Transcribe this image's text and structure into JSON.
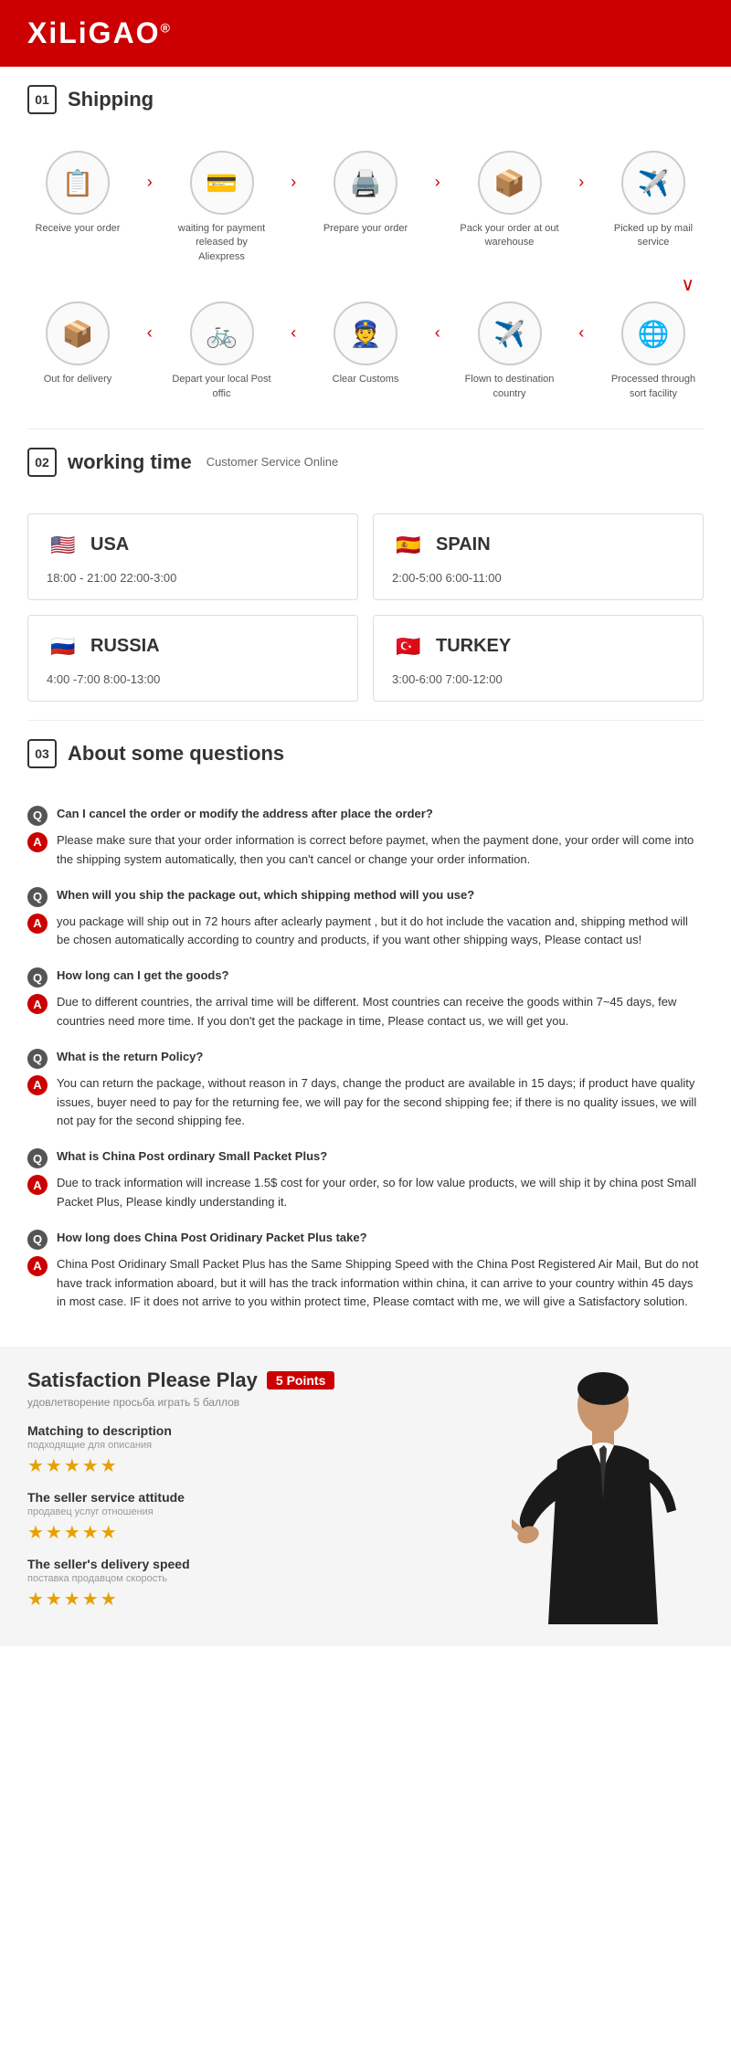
{
  "header": {
    "logo": "XiLiGAO",
    "trademark": "®"
  },
  "shipping": {
    "section_num": "01",
    "section_label": "Shipping",
    "row1": [
      {
        "icon": "📋",
        "label": "Receive your order"
      },
      {
        "arrow": ">"
      },
      {
        "icon": "💳",
        "label": "waiting for payment released by Aliexpress"
      },
      {
        "arrow": ">"
      },
      {
        "icon": "🖨️",
        "label": "Prepare your order"
      },
      {
        "arrow": ">"
      },
      {
        "icon": "📦",
        "label": "Pack your order at out warehouse"
      },
      {
        "arrow": ">"
      },
      {
        "icon": "✈️",
        "label": "Picked up by mail service"
      }
    ],
    "arrow_down": "∨",
    "row2": [
      {
        "icon": "📦",
        "label": "Out for delivery"
      },
      {
        "arrow": "<"
      },
      {
        "icon": "🚲",
        "label": "Depart your local Post offic"
      },
      {
        "arrow": "<"
      },
      {
        "icon": "👮",
        "label": "Clear Customs"
      },
      {
        "arrow": "<"
      },
      {
        "icon": "✈️",
        "label": "Flown to destination country"
      },
      {
        "arrow": "<"
      },
      {
        "icon": "🌐",
        "label": "Processed through sort facility"
      }
    ]
  },
  "working": {
    "section_num": "02",
    "section_label": "working time",
    "section_sublabel": "Customer Service Online",
    "countries": [
      {
        "flag": "🇺🇸",
        "name": "USA",
        "times": "18:00 - 21:00  22:00-3:00"
      },
      {
        "flag": "🇪🇸",
        "name": "SPAIN",
        "times": "2:00-5:00  6:00-11:00"
      },
      {
        "flag": "🇷🇺",
        "name": "RUSSIA",
        "times": "4:00 -7:00  8:00-13:00"
      },
      {
        "flag": "🇹🇷",
        "name": "TURKEY",
        "times": "3:00-6:00  7:00-12:00"
      }
    ]
  },
  "questions": {
    "section_num": "03",
    "section_label": "About some questions",
    "items": [
      {
        "q": "Can I cancel the order or modify the address after place the order?",
        "a": "Please make sure that your order information is correct before paymet, when the payment done, your order will come into the shipping system automatically, then you can't cancel or change your order information."
      },
      {
        "q": "When will you ship the package out, which shipping method will you use?",
        "a": "you package will ship out in 72 hours after aclearly payment , but it do hot include the vacation and, shipping method will be chosen automatically according to country and products, if you want other shipping ways, Please contact us!"
      },
      {
        "q": "How long can I get the goods?",
        "a": "Due to different countries, the arrival time will be different. Most countries can receive the goods within 7~45 days, few countries need more time. If you don't get the package in time, Please contact us, we will get you."
      },
      {
        "q": "What is the return Policy?",
        "a": "You can return the package, without reason in 7 days, change the product are available in 15 days; if product have quality issues, buyer need to pay for the returning fee, we will pay for the second shipping fee; if there is no quality issues, we will not pay for the second shipping fee."
      },
      {
        "q": "What is China Post ordinary Small Packet Plus?",
        "a": "Due to track information will increase 1.5$ cost for your order, so for low value products, we will ship it by china post Small Packet Plus, Please kindly understanding it."
      },
      {
        "q": "How long does China Post Oridinary Packet Plus take?",
        "a": "China Post Oridinary Small Packet Plus has the Same Shipping Speed with the China Post Registered Air Mail, But do not have track information aboard, but it will has the track information within china, it can arrive to your country within 45 days in most case. IF it does not arrive to you within protect time, Please comtact with me, we will give a Satisfactory solution."
      }
    ]
  },
  "satisfaction": {
    "title": "Satisfaction Please Play",
    "points_badge": "5 Points",
    "subtitle": "удовлетворение просьба играть 5 баллов",
    "ratings": [
      {
        "title": "Matching to description",
        "subtitle": "подходящие для описания",
        "stars": "★★★★★"
      },
      {
        "title": "The seller service attitude",
        "subtitle": "продавец услуг отношения",
        "stars": "★★★★★"
      },
      {
        "title": "The seller's delivery speed",
        "subtitle": "поставка продавцом скорость",
        "stars": "★★★★★"
      }
    ]
  }
}
